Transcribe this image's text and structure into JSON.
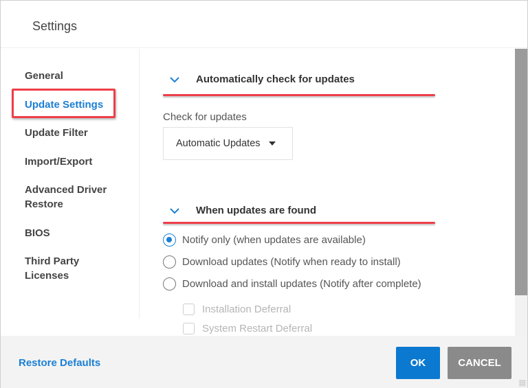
{
  "dialog": {
    "title": "Settings"
  },
  "sidebar": {
    "items": [
      {
        "label": "General",
        "active": false
      },
      {
        "label": "Update Settings",
        "active": true
      },
      {
        "label": "Update Filter",
        "active": false
      },
      {
        "label": "Import/Export",
        "active": false
      },
      {
        "label": "Advanced Driver Restore",
        "line1": "Advanced Driver",
        "line2": "Restore",
        "active": false
      },
      {
        "label": "BIOS",
        "active": false
      },
      {
        "label": "Third Party Licenses",
        "line1": "Third Party",
        "line2": "Licenses",
        "active": false
      }
    ]
  },
  "main": {
    "section_check": {
      "title": "Automatically check for updates",
      "icon": "chevron-down-icon",
      "field_label": "Check for updates",
      "dropdown_value": "Automatic Updates"
    },
    "section_found": {
      "title": "When updates are found",
      "icon": "chevron-down-icon",
      "options": [
        {
          "label": "Notify only (when updates are available)",
          "checked": true
        },
        {
          "label": "Download updates (Notify when ready to install)",
          "checked": false
        },
        {
          "label": "Download and install updates (Notify after complete)",
          "checked": false
        }
      ],
      "sub_options": [
        {
          "label": "Installation Deferral",
          "checked": false,
          "disabled": true
        },
        {
          "label": "System Restart Deferral",
          "checked": false,
          "disabled": true
        }
      ]
    }
  },
  "scrollbar": {
    "visible_fraction": 0.86,
    "scroll_position": 0
  },
  "footer": {
    "restore_defaults": "Restore Defaults",
    "ok": "OK",
    "cancel": "CANCEL"
  },
  "colors": {
    "accent": "#0b79d0",
    "link": "#1a7fd4",
    "annotation_red": "#ee3e48",
    "cancel_gray": "#8a8a8a"
  }
}
